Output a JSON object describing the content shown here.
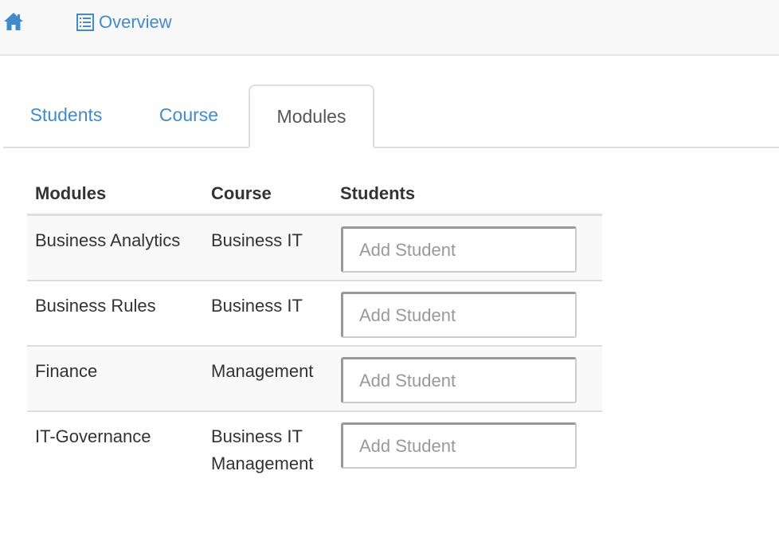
{
  "navbar": {
    "home_icon": "home-icon",
    "overview_icon": "list-icon",
    "overview_label": "Overview"
  },
  "tabs": [
    {
      "label": "Students",
      "active": false
    },
    {
      "label": "Course",
      "active": false
    },
    {
      "label": "Modules",
      "active": true
    }
  ],
  "table": {
    "headers": [
      "Modules",
      "Course",
      "Students"
    ],
    "rows": [
      {
        "module": "Business Analytics",
        "course": "Business IT",
        "placeholder": "Add Student"
      },
      {
        "module": "Business Rules",
        "course": "Business IT",
        "placeholder": "Add Student"
      },
      {
        "module": "Finance",
        "course": "Management",
        "placeholder": "Add Student"
      },
      {
        "module": "IT-Governance",
        "course": "Business IT Management",
        "placeholder": "Add Student"
      }
    ]
  },
  "colors": {
    "link": "#428bca",
    "text": "#333333",
    "navbar_bg": "#f8f8f8",
    "border": "#dddddd"
  }
}
